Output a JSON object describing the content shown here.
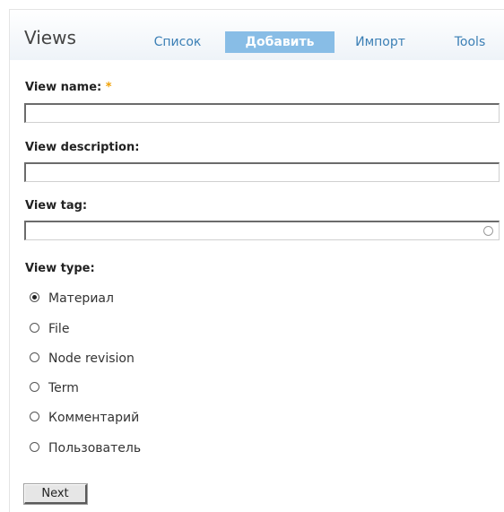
{
  "header": {
    "title": "Views",
    "tabs": [
      {
        "label": "Список"
      },
      {
        "label": "Добавить"
      },
      {
        "label": "Импорт"
      },
      {
        "label": "Tools"
      }
    ]
  },
  "form": {
    "view_name": {
      "label": "View name:",
      "required_mark": "*",
      "value": ""
    },
    "view_description": {
      "label": "View description:",
      "value": ""
    },
    "view_tag": {
      "label": "View tag:",
      "value": ""
    },
    "view_type": {
      "label": "View type:",
      "selected": "Материал",
      "options": [
        "Материал",
        "File",
        "Node revision",
        "Term",
        "Комментарий",
        "Пользователь"
      ]
    },
    "submit_label": "Next"
  },
  "colors": {
    "active_tab_bg": "#88bde6",
    "tab_link": "#3b7fb5",
    "required": "#f0a000"
  }
}
